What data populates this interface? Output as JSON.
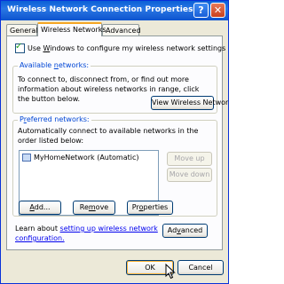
{
  "window": {
    "title": "Wireless Network Connection Properties"
  },
  "tabs": [
    {
      "label": "General"
    },
    {
      "label": "Wireless Networks"
    },
    {
      "label": "Advanced"
    }
  ],
  "use_windows": {
    "label_pre": "Use ",
    "label_key": "W",
    "label_post": "indows to configure my wireless network settings",
    "checked": true
  },
  "available": {
    "legend_pre": "Available ",
    "legend_key": "n",
    "legend_post": "etworks:",
    "description": "To connect to, disconnect from, or find out more information about wireless networks in range, click the button below.",
    "view_button": "View Wireless Networks"
  },
  "preferred": {
    "legend_pre": "P",
    "legend_key": "r",
    "legend_post": "eferred networks:",
    "description": "Automatically connect to available networks in the order listed below:",
    "networks": [
      {
        "label": "MyHomeNetwork (Automatic)"
      }
    ],
    "move_up": "Move up",
    "move_down": "Move down",
    "add_key": "A",
    "add_rest": "dd...",
    "remove_pre": "Re",
    "remove_key": "m",
    "remove_post": "ove",
    "properties_pre": "Pr",
    "properties_key": "o",
    "properties_post": "perties"
  },
  "learn": {
    "text": "Learn about ",
    "link": "setting up wireless network configuration.",
    "advanced_pre": "Ad",
    "advanced_key": "v",
    "advanced_post": "anced"
  },
  "footer": {
    "ok": "OK",
    "cancel": "Cancel"
  }
}
